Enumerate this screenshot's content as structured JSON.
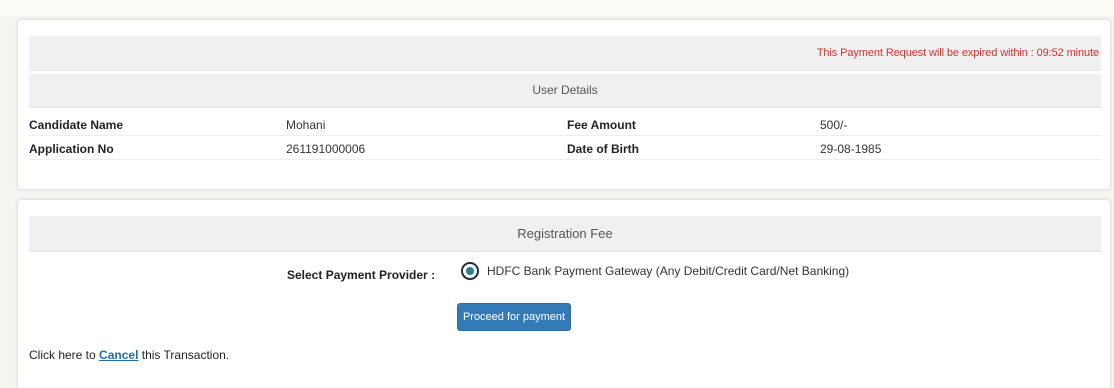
{
  "expiry_notice": {
    "text": "This Payment Request will be expired within : 09:52 minute",
    "color": "#d0342c"
  },
  "user_details": {
    "header": "User Details",
    "rows": [
      {
        "label_1": "Candidate Name",
        "value_1": "Mohani",
        "label_2": "Fee Amount",
        "value_2": "500/-"
      },
      {
        "label_1": "Application No",
        "value_1": "261191000006",
        "label_2": "Date of Birth",
        "value_2": "29-08-1985"
      }
    ]
  },
  "registration": {
    "header": "Registration Fee",
    "provider_label": "Select Payment Provider :",
    "provider_option": "HDFC Bank Payment Gateway (Any Debit/Credit Card/Net Banking)",
    "provider_selected": true,
    "proceed_label": "Proceed for payment",
    "button_color": "#337ab7"
  },
  "cancel": {
    "prefix": "Click here to",
    "link_text": "Cancel",
    "suffix": "this Transaction."
  }
}
